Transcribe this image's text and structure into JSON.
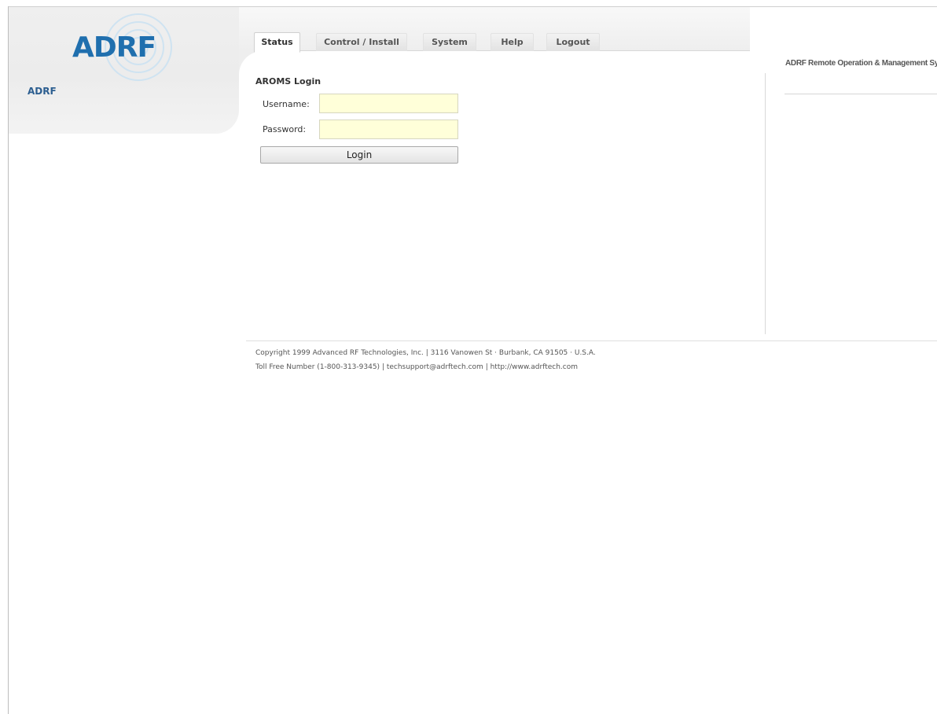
{
  "brand": {
    "logo_text": "ADRF",
    "site_name": "ADRF",
    "logo_color": "#1f6fae"
  },
  "nav": {
    "tabs": [
      {
        "label": "Status",
        "active": true
      },
      {
        "label": "Control / Install",
        "active": false
      },
      {
        "label": "System",
        "active": false
      },
      {
        "label": "Help",
        "active": false
      },
      {
        "label": "Logout",
        "active": false
      }
    ]
  },
  "right_panel": {
    "title": "ADRF Remote Operation & Management System"
  },
  "login": {
    "title": "AROMS Login",
    "username_label": "Username:",
    "username_value": "",
    "password_label": "Password:",
    "password_value": "",
    "button_label": "Login",
    "input_bg": "#ffffd9"
  },
  "footer": {
    "line1": "Copyright 1999 Advanced RF Technologies, Inc. | 3116 Vanowen St · Burbank, CA 91505 · U.S.A.",
    "line2": "Toll Free Number (1-800-313-9345) | techsupport@adrftech.com | http://www.adrftech.com"
  }
}
